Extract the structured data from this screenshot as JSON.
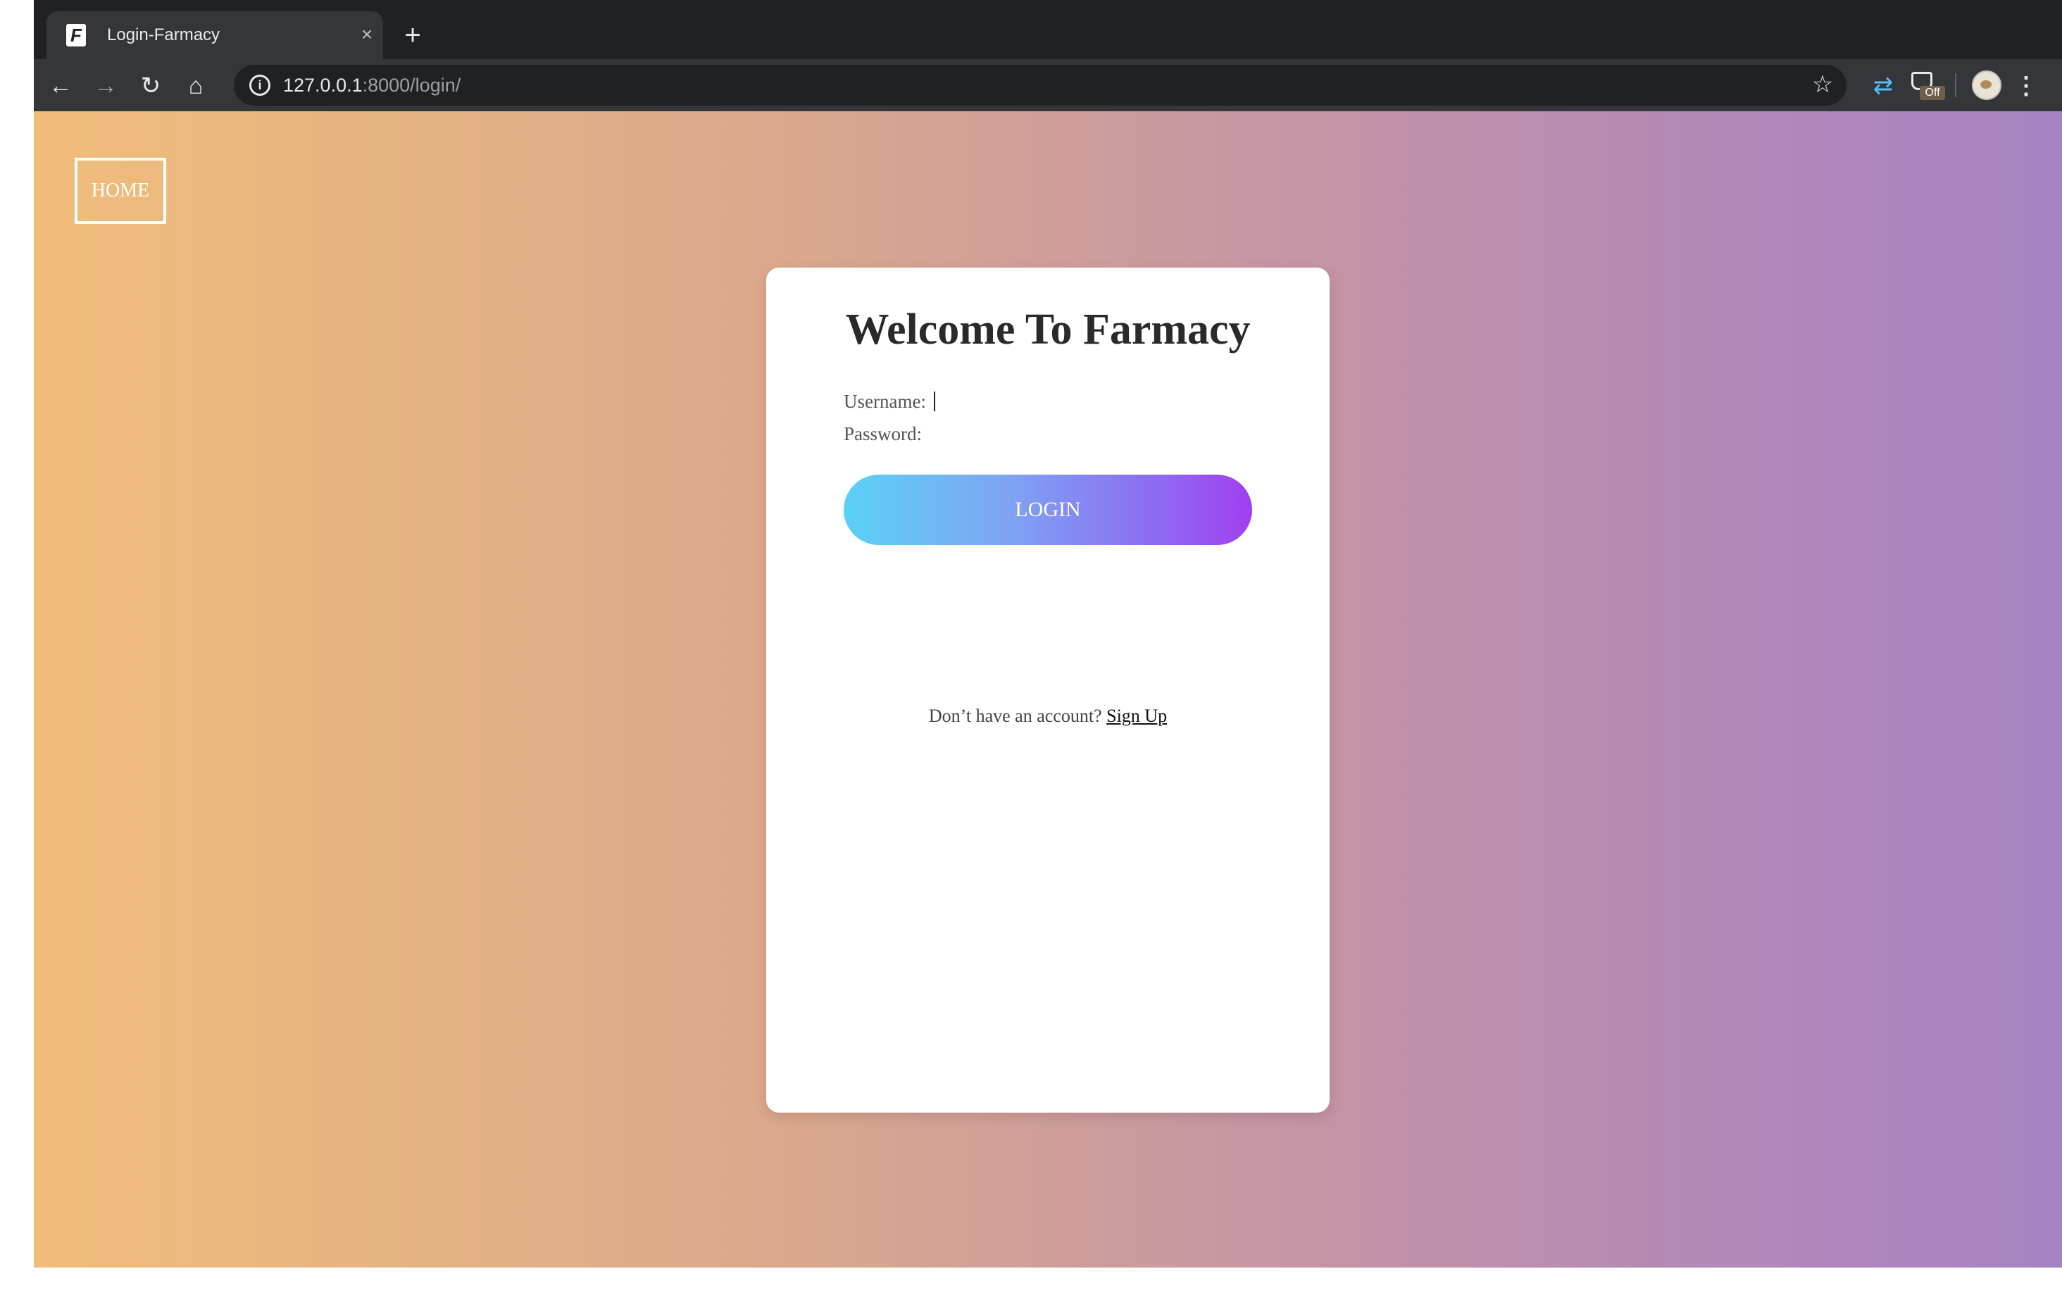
{
  "browser": {
    "tab_title": "Login-Farmacy",
    "tab_favicon": "F",
    "tab_close": "×",
    "new_tab": "+",
    "url_host": "127.0.0.1",
    "url_rest": ":8000/login/",
    "back": "←",
    "forward": "→",
    "reload": "↻",
    "home": "⌂",
    "star": "☆",
    "extension_badge": "Off",
    "menu": "⋮"
  },
  "page": {
    "home_label": "HOME",
    "title": "Welcome To Farmacy",
    "username_label": "Username:",
    "password_label": "Password:",
    "username_value": "",
    "password_value": "",
    "login_label": "LOGIN",
    "signup_prompt": "Don’t have an account?",
    "signup_link": "Sign Up"
  },
  "colors": {
    "background_gradient": [
      "#f0bd7a",
      "#dca98b",
      "#c896a2",
      "#b48ab5",
      "#a882c3"
    ],
    "login_gradient": [
      "#5ad1f7",
      "#7ea4f2",
      "#8d6df2",
      "#a13ff0"
    ],
    "card": "#ffffff"
  }
}
